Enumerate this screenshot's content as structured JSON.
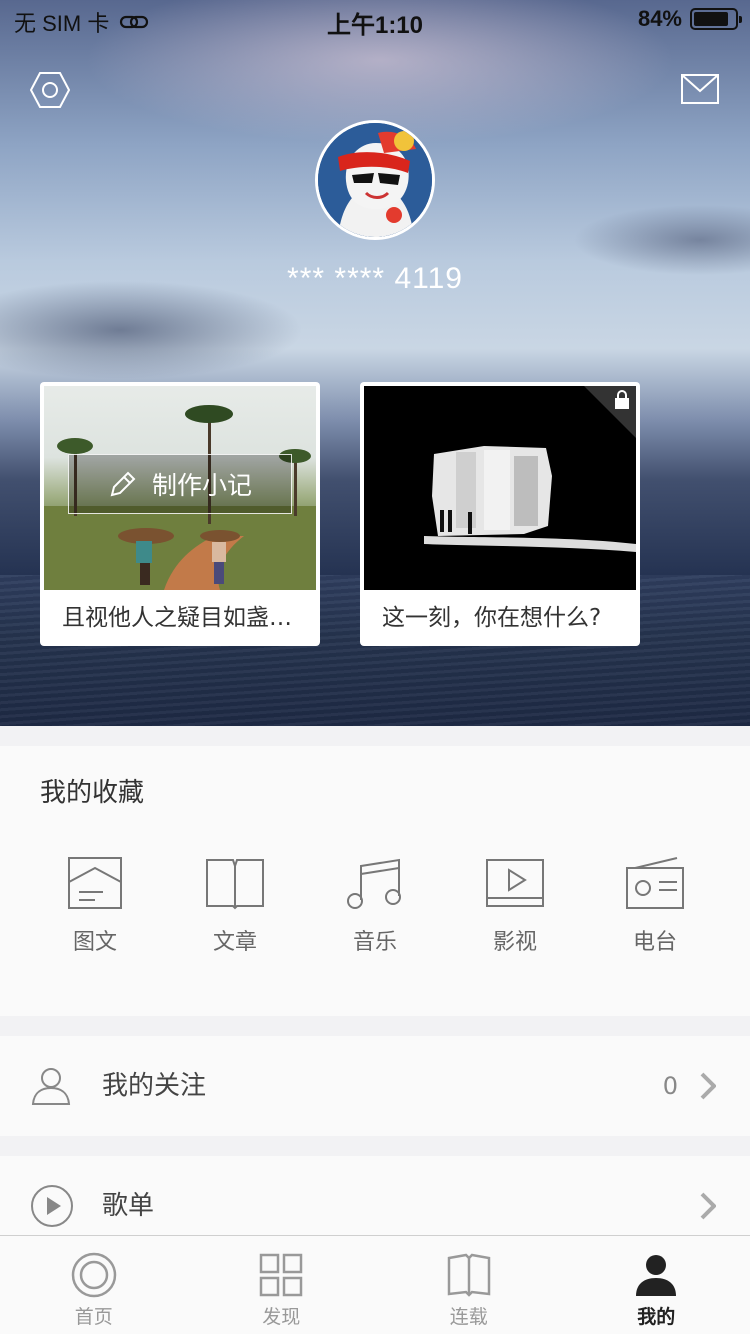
{
  "status_bar": {
    "carrier": "无 SIM 卡",
    "time": "上午1:10",
    "battery": "84%",
    "battery_level": 0.84
  },
  "profile": {
    "username": "*** **** 4119"
  },
  "cards": [
    {
      "caption": "且视他人之疑目如盏盏鬼火",
      "button": "制作小记"
    },
    {
      "caption": "这一刻，你在想什么?"
    }
  ],
  "favorites": {
    "title": "我的收藏",
    "items": [
      {
        "label": "图文",
        "icon": "picture-text-icon"
      },
      {
        "label": "文章",
        "icon": "book-icon"
      },
      {
        "label": "音乐",
        "icon": "music-note-icon"
      },
      {
        "label": "影视",
        "icon": "video-icon"
      },
      {
        "label": "电台",
        "icon": "radio-icon"
      }
    ]
  },
  "rows": [
    {
      "label": "我的关注",
      "count": "0",
      "icon": "person-icon"
    },
    {
      "label": "歌单",
      "icon": "play-icon"
    }
  ],
  "tabs": [
    {
      "label": "首页",
      "icon": "home-circle-icon"
    },
    {
      "label": "发现",
      "icon": "grid-icon"
    },
    {
      "label": "连载",
      "icon": "book-icon"
    },
    {
      "label": "我的",
      "icon": "person-filled-icon"
    }
  ],
  "active_tab": "我的"
}
